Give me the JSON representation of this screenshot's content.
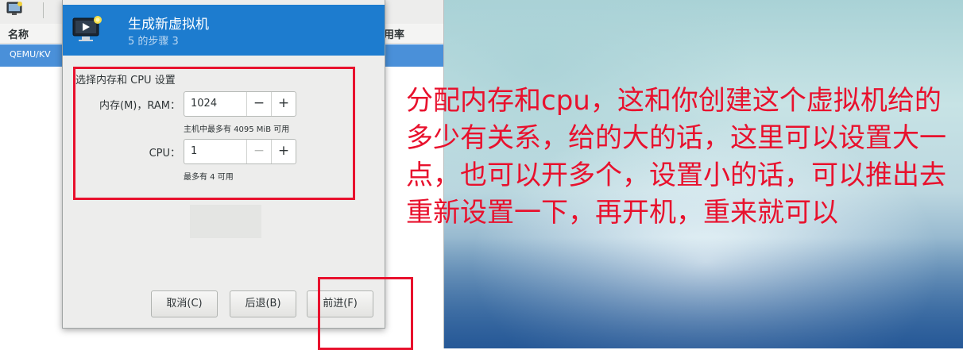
{
  "background_window": {
    "column_name": "名称",
    "column_rate": "用率",
    "connection_label": "QEMU/KV"
  },
  "dialog": {
    "title": "生成新虚拟机",
    "step": "5 的步骤 3",
    "section_title": "选择内存和 CPU 设置",
    "memory": {
      "label": "内存(M)，RAM：",
      "value": "1024",
      "minus": "−",
      "plus": "+",
      "hint": "主机中最多有 4095 MiB 可用"
    },
    "cpu": {
      "label": "CPU：",
      "value": "1",
      "minus": "−",
      "plus": "+",
      "hint": "最多有 4 可用"
    },
    "buttons": {
      "cancel": "取消(C)",
      "back": "后退(B)",
      "forward": "前进(F)"
    }
  },
  "annotation": {
    "text": "分配内存和cpu，这和你创建这个虚拟机给的多少有关系，给的大的话，这里可以设置大一点，也可以开多个，设置小的话，可以推出去重新设置一下，再开机，重来就可以",
    "color": "#e8112d"
  },
  "colors": {
    "header_blue": "#1d7ccf",
    "selection_blue": "#4a90d9"
  }
}
